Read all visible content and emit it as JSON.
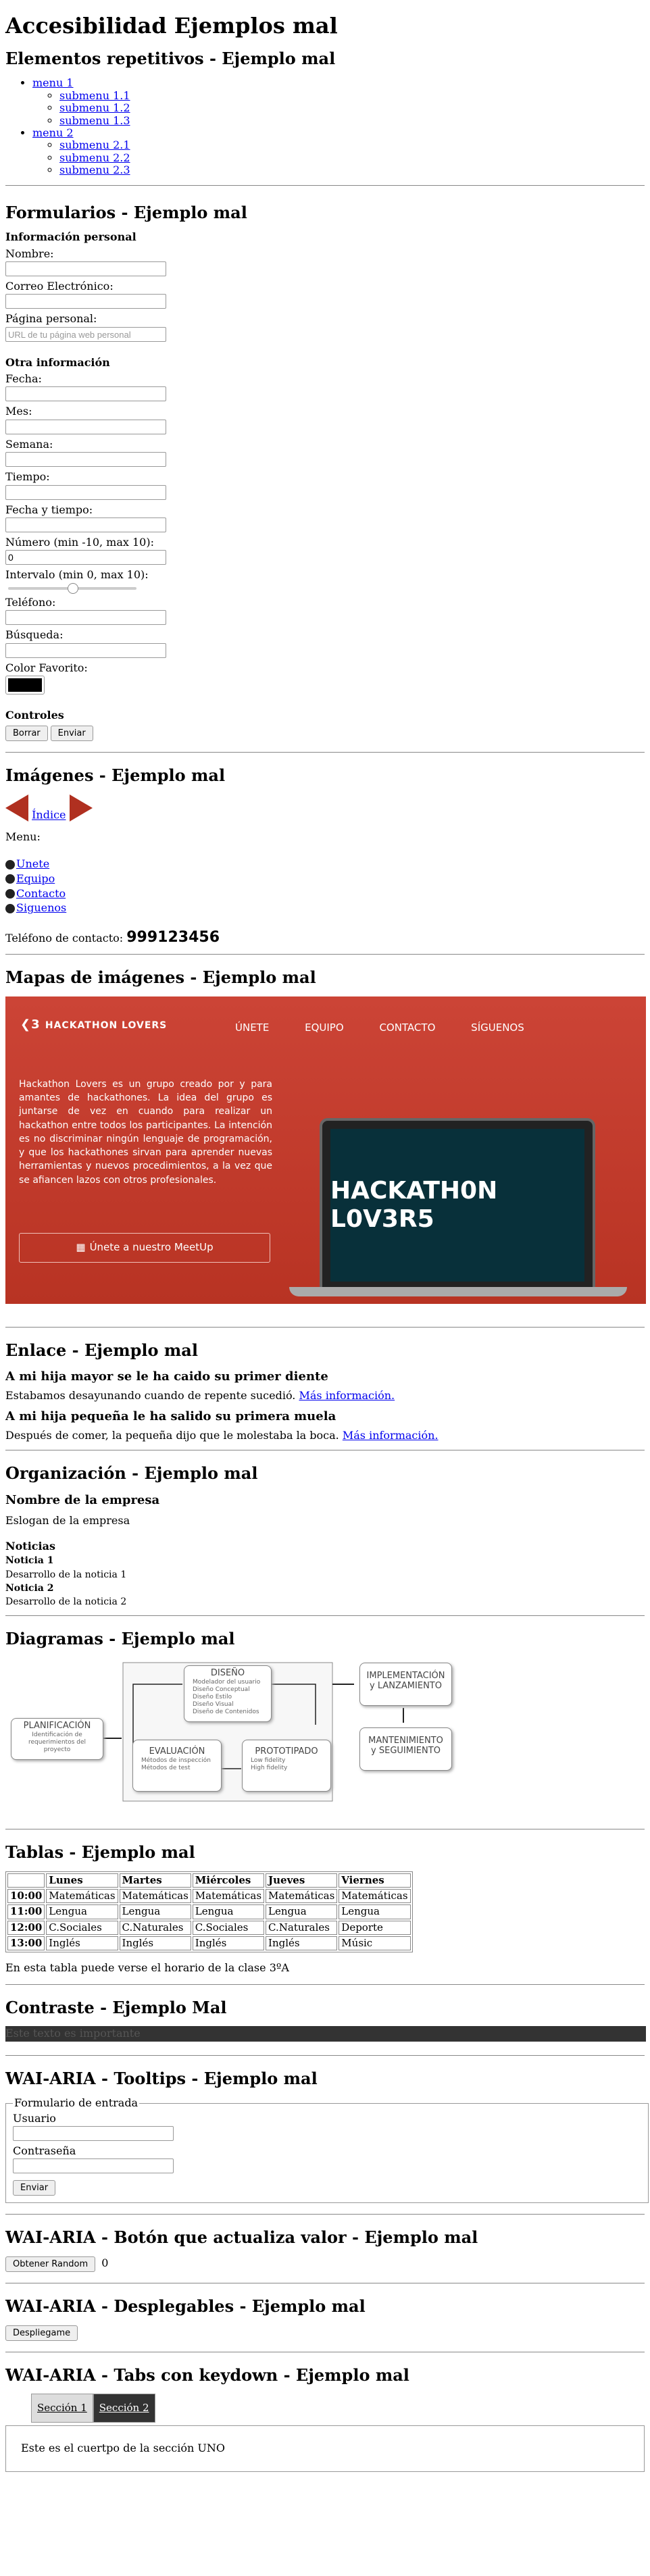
{
  "page": {
    "title": "Accesibilidad Ejemplos mal"
  },
  "rep": {
    "heading": "Elementos repetitivos - Ejemplo mal",
    "menus": [
      {
        "label": "menu 1",
        "sub": [
          "submenu 1.1",
          "submenu 1.2",
          "submenu 1.3"
        ]
      },
      {
        "label": "menu 2",
        "sub": [
          "submenu 2.1",
          "submenu 2.2",
          "submenu 2.3"
        ]
      }
    ]
  },
  "forms": {
    "heading": "Formularios - Ejemplo mal",
    "personal_title": "Información personal",
    "name_label": "Nombre:",
    "email_label": "Correo Electrónico:",
    "web_label": "Página personal:",
    "web_placeholder": "URL de tu página web personal",
    "other_title": "Otra información",
    "date_label": "Fecha:",
    "month_label": "Mes:",
    "week_label": "Semana:",
    "time_label": "Tiempo:",
    "datetime_label": "Fecha y tiempo:",
    "number_label": "Número (min -10, max 10):",
    "number_value": "0",
    "range_label": "Intervalo (min 0, max 10):",
    "range_value": 0.5,
    "phone_label": "Teléfono:",
    "search_label": "Búsqueda:",
    "color_label": "Color Favorito:",
    "color_value": "#000000",
    "controls_title": "Controles",
    "clear_btn": "Borrar",
    "send_btn": "Enviar"
  },
  "images": {
    "heading": "Imágenes - Ejemplo mal",
    "index_link": "Índice",
    "menu_label": "Menu:",
    "items": [
      "Unete",
      "Equipo",
      "Contacto",
      "Siguenos"
    ],
    "phone_label": "Teléfono de contacto:",
    "phone": "999123456",
    "arrow_color": "#b03020"
  },
  "imagemap": {
    "heading": "Mapas de imágenes - Ejemplo mal",
    "logo": "HACKATHON LOVERS",
    "nav": [
      "ÚNETE",
      "EQUIPO",
      "CONTACTO",
      "SÍGUENOS"
    ],
    "intro": "Hackathon Lovers es un grupo creado por y para amantes de hackathones. La idea del grupo es juntarse de vez en cuando para realizar un hackathon entre todos los participantes. La intención es no discriminar ningún lenguaje de programación, y que los hackathones sirvan para aprender nuevas herramientas y nuevos procedimientos, a la vez que se afiancen lazos con otros profesionales.",
    "meetup": "Únete a nuestro MeetUp",
    "screen_logo": "HACKATH0N L0V3R5",
    "bg_color": "#c0392b"
  },
  "links": {
    "heading": "Enlace - Ejemplo mal",
    "h1": "A mi hija mayor se le ha caido su primer diente",
    "p1": "Estabamos desayunando cuando de repente sucedió.",
    "h2": "A mi hija pequeña le ha salido su primera muela",
    "p2": "Después de comer, la pequeña dijo que le molestaba la boca.",
    "more": "Más información."
  },
  "org": {
    "heading": "Organización - Ejemplo mal",
    "company": "Nombre de la empresa",
    "slogan": "Eslogan de la empresa",
    "news_title": "Noticias",
    "news": [
      {
        "title": "Noticia 1",
        "body": "Desarrollo de la noticia 1"
      },
      {
        "title": "Noticia 2",
        "body": "Desarrollo de la noticia 2"
      }
    ]
  },
  "diagram": {
    "heading": "Diagramas - Ejemplo mal",
    "planning": {
      "label": "PLANIFICACIÓN",
      "sub": "Identificación de requerimientos del proyecto"
    },
    "design": {
      "label": "DISEÑO",
      "sub": [
        "Modelador del usuario",
        "Diseño Conceptual",
        "Diseño Estilo",
        "Diseño Visual",
        "Diseño de Contenidos"
      ]
    },
    "eval": {
      "label": "EVALUACIÓN",
      "sub": [
        "Métodos de inspección",
        "Métodos de test"
      ]
    },
    "proto": {
      "label": "PROTOTIPADO",
      "sub": [
        "Low fidelity",
        "High fidelity"
      ]
    },
    "impl": {
      "label": "IMPLEMENTACIÓN y LANZAMIENTO"
    },
    "maint": {
      "label": "MANTENIMIENTO y SEGUIMIENTO"
    }
  },
  "tables": {
    "heading": "Tablas - Ejemplo mal",
    "headers": [
      "",
      "Lunes",
      "Martes",
      "Miércoles",
      "Jueves",
      "Viernes"
    ],
    "rows": [
      [
        "10:00",
        "Matemáticas",
        "Matemáticas",
        "Matemáticas",
        "Matemáticas",
        "Matemáticas"
      ],
      [
        "11:00",
        "Lengua",
        "Lengua",
        "Lengua",
        "Lengua",
        "Lengua"
      ],
      [
        "12:00",
        "C.Sociales",
        "C.Naturales",
        "C.Sociales",
        "C.Naturales",
        "Deporte"
      ],
      [
        "13:00",
        "Inglés",
        "Inglés",
        "Inglés",
        "Inglés",
        "Músic"
      ]
    ],
    "caption": "En esta tabla puede verse el horario de la clase 3ºA"
  },
  "contrast": {
    "heading": "Contraste - Ejemplo Mal",
    "text": "Este texto es importante"
  },
  "tooltips": {
    "heading": "WAI-ARIA - Tooltips - Ejemplo mal",
    "legend": "Formulario de entrada",
    "user": "Usuario",
    "pass": "Contraseña",
    "send": "Enviar"
  },
  "random": {
    "heading": "WAI-ARIA - Botón que actualiza valor - Ejemplo mal",
    "btn": "Obtener Random",
    "value": "0"
  },
  "dropdown": {
    "heading": "WAI-ARIA - Desplegables - Ejemplo mal",
    "btn": "Despliegame"
  },
  "tabs": {
    "heading": "WAI-ARIA - Tabs con keydown - Ejemplo mal",
    "tab1": "Sección 1",
    "tab2": "Sección 2",
    "body": "Este es el cuertpo de la sección UNO"
  }
}
